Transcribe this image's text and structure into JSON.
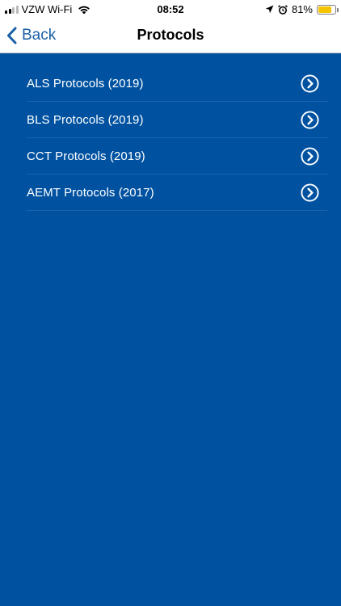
{
  "status_bar": {
    "carrier": "VZW Wi-Fi",
    "time": "08:52",
    "battery_percent": "81%",
    "battery_level": 0.81,
    "icons": [
      "signal-bars-icon",
      "wifi-icon",
      "location-arrow-icon",
      "alarm-clock-icon",
      "battery-icon"
    ]
  },
  "nav": {
    "back_label": "Back",
    "title": "Protocols"
  },
  "protocols": [
    {
      "label": "ALS Protocols (2019)"
    },
    {
      "label": "BLS Protocols (2019)"
    },
    {
      "label": "CCT Protocols (2019)"
    },
    {
      "label": "AEMT Protocols (2017)"
    }
  ],
  "colors": {
    "background": "#0052a1",
    "accent": "#1a5fa6",
    "battery": "#f5c400"
  }
}
